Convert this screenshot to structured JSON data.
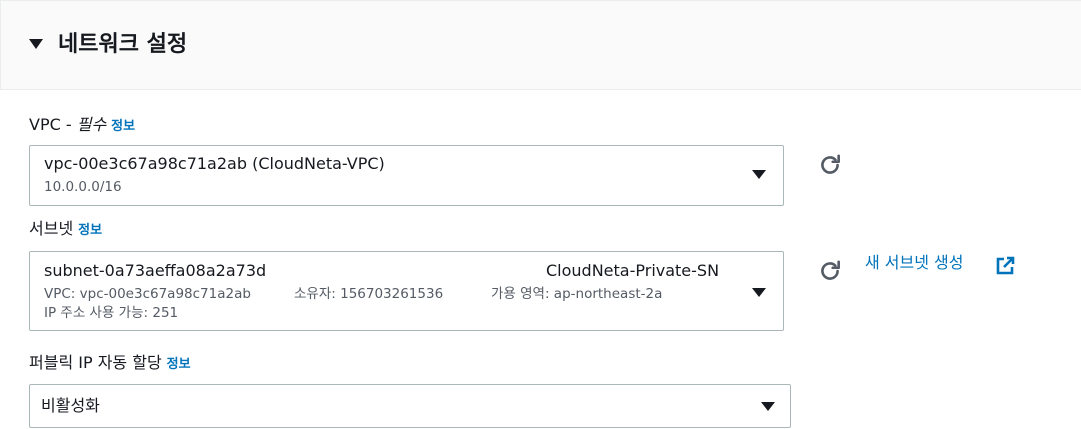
{
  "section": {
    "title": "네트워크 설정"
  },
  "vpc": {
    "label": "VPC - ",
    "required": "필수",
    "info": "정보",
    "selected": "vpc-00e3c67a98c71a2ab (CloudNeta-VPC)",
    "cidr": "10.0.0.0/16"
  },
  "subnet": {
    "label": "서브넷",
    "info": "정보",
    "selected_id": "subnet-0a73aeffa08a2a73d",
    "selected_name": "CloudNeta-Private-SN",
    "vpc_detail": "VPC: vpc-00e3c67a98c71a2ab",
    "owner_detail": "소유자: 156703261536",
    "az_detail": "가용 영역: ap-northeast-2a",
    "ip_detail": "IP 주소 사용 가능: 251",
    "create_link": "새 서브넷 생성"
  },
  "public_ip": {
    "label": "퍼블릭 IP 자동 할당",
    "info": "정보",
    "selected": "비활성화"
  },
  "icons": [
    "caret-down-icon",
    "refresh-icon",
    "external-link-icon"
  ],
  "colors": {
    "link": "#0073bb",
    "text": "#16191f",
    "secondary_text": "#545b64",
    "border": "#aab7b8",
    "header_bg": "#fafafa"
  }
}
